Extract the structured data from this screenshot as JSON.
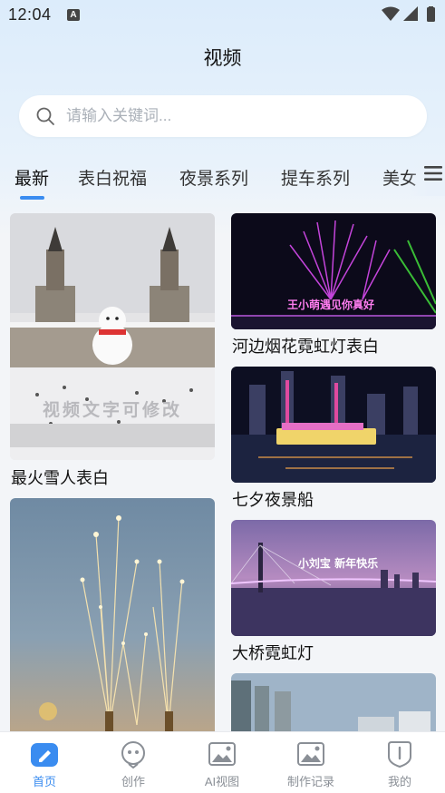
{
  "status_bar": {
    "time": "12:04",
    "notification_letter": "A"
  },
  "header": {
    "title": "视频"
  },
  "search": {
    "placeholder": "请输入关键词..."
  },
  "tabs": [
    {
      "label": "最新",
      "active": true
    },
    {
      "label": "表白祝福",
      "active": false
    },
    {
      "label": "夜景系列",
      "active": false
    },
    {
      "label": "提车系列",
      "active": false
    },
    {
      "label": "美女",
      "active": false
    }
  ],
  "feed": {
    "left": [
      {
        "title": "最火雪人表白",
        "overlay_text": "视频文字可修改",
        "thumb": "snowman-castle"
      },
      {
        "title": "",
        "thumb": "fireworks-fountain"
      }
    ],
    "right": [
      {
        "title": "河边烟花霓虹灯表白",
        "overlay_text": "王小萌遇见你真好",
        "thumb": "riverside-fireworks"
      },
      {
        "title": "七夕夜景船",
        "thumb": "night-boat"
      },
      {
        "title": "大桥霓虹灯",
        "overlay_text": "小刘宝 新年快乐",
        "thumb": "bridge-neon"
      },
      {
        "title": "",
        "thumb": "city-buildings"
      }
    ]
  },
  "bottom_nav": [
    {
      "label": "首页",
      "icon": "home-pen-icon",
      "active": true
    },
    {
      "label": "创作",
      "icon": "create-face-icon",
      "active": false
    },
    {
      "label": "AI视图",
      "icon": "ai-image-icon",
      "active": false
    },
    {
      "label": "制作记录",
      "icon": "records-image-icon",
      "active": false
    },
    {
      "label": "我的",
      "icon": "profile-icon",
      "active": false
    }
  ],
  "colors": {
    "accent": "#3a8cf0",
    "inactive": "#8a8f96",
    "background": "#f3f5f8"
  }
}
